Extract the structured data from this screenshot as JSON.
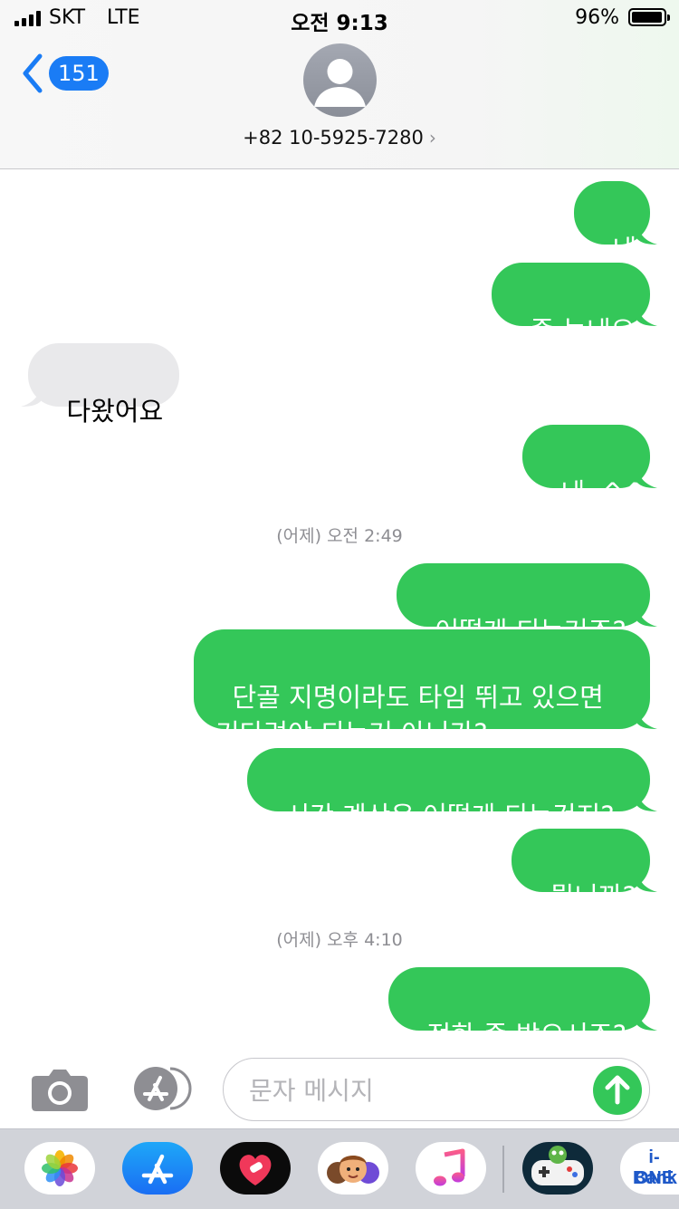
{
  "status_bar": {
    "carrier": "SKT",
    "network": "LTE",
    "time": "오전 9:13",
    "battery_percent_text": "96%",
    "battery_level": 0.96
  },
  "header": {
    "unread_badge": "151",
    "contact": "+82 10-5925-7280",
    "contact_chevron": "›"
  },
  "messages": [
    {
      "dir": "out",
      "text": "네"
    },
    {
      "dir": "out",
      "text": "좀 늦네요"
    },
    {
      "dir": "in",
      "text": "다왔어요"
    },
    {
      "dir": "out",
      "text": "네. ^^*"
    },
    {
      "timestamp_day": "(어제)",
      "timestamp_time": "오전 2:49"
    },
    {
      "dir": "out",
      "text": "어떻게 되는거죠?"
    },
    {
      "dir": "out",
      "text": "단골 지명이라도 타임 뛰고 있으면\n기다려야 되는거 아닌가?"
    },
    {
      "dir": "out",
      "text": "시간 계산은 어떻게 되는건지?"
    },
    {
      "dir": "out",
      "text": "뭡니까?"
    },
    {
      "timestamp_day": "(어제)",
      "timestamp_time": "오후 4:10"
    },
    {
      "dir": "out",
      "text": "전화 좀 받으시죠?"
    }
  ],
  "composer": {
    "placeholder": "문자 메시지"
  },
  "app_drawer": {
    "apps": [
      "photos-app",
      "app-store-app",
      "heart-app",
      "memoji-app",
      "music-app",
      "game-app",
      "ione-bank-app"
    ],
    "ione_line1": "i-ONE",
    "ione_line2": "Bank"
  },
  "colors": {
    "outgoing": "#34c759",
    "incoming": "#e9e9eb",
    "accent": "#1a7cf5",
    "timestamp": "#8e8e93"
  }
}
